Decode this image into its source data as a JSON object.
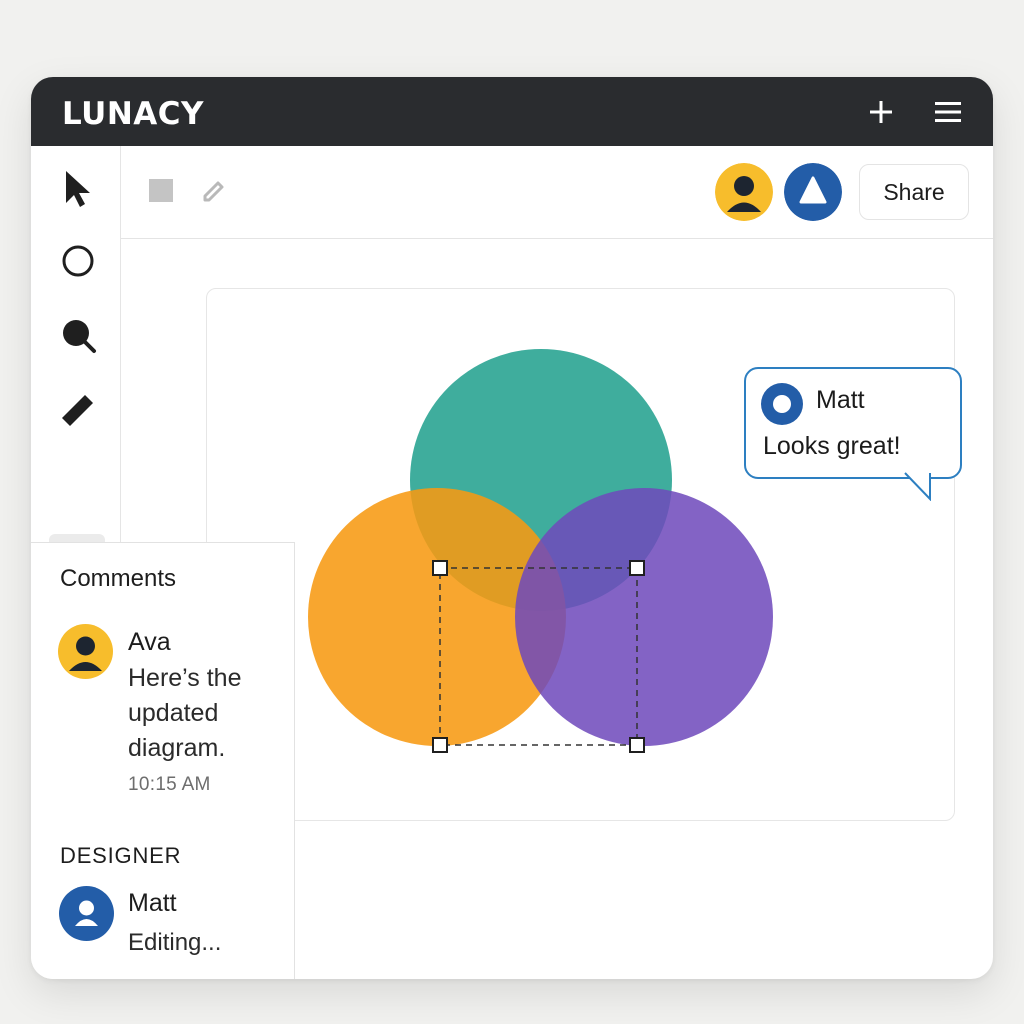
{
  "app": {
    "title": "LUNACY"
  },
  "titlebar": {
    "add_icon": "plus-icon",
    "menu_icon": "hamburger-menu-icon"
  },
  "toolbar": {
    "tools": [
      {
        "name": "select",
        "icon": "cursor-arrow-icon"
      },
      {
        "name": "ellipse",
        "icon": "circle-outline-icon"
      },
      {
        "name": "zoom",
        "icon": "magnifier-icon"
      },
      {
        "name": "pen",
        "icon": "ruler-pencil-icon"
      },
      {
        "name": "rectangle",
        "icon": "square-outline-icon",
        "active": true
      }
    ]
  },
  "topbar": {
    "fill_icon": "square-fill-icon",
    "edit_icon": "pencil-icon",
    "share_label": "Share",
    "collaborators": [
      {
        "avatar": "user-avatar-yellow",
        "color": "#f7bd2c"
      },
      {
        "avatar": "triangle-avatar-blue",
        "color": "#235da8"
      }
    ]
  },
  "canvas": {
    "circles": [
      {
        "name": "teal",
        "color": "#39b0a0"
      },
      {
        "name": "orange",
        "color": "#f7a42a"
      },
      {
        "name": "purple",
        "color": "#8060c5"
      }
    ]
  },
  "comment_bubble": {
    "author": "Matt",
    "text": "Looks great!"
  },
  "comments": {
    "title": "Comments",
    "items": [
      {
        "author": "Ava",
        "text": "Here’s the updated diagram.",
        "time": "10:15 AM"
      }
    ]
  },
  "designer": {
    "title": "DESIGNER",
    "name": "Matt",
    "status": "Editing..."
  }
}
